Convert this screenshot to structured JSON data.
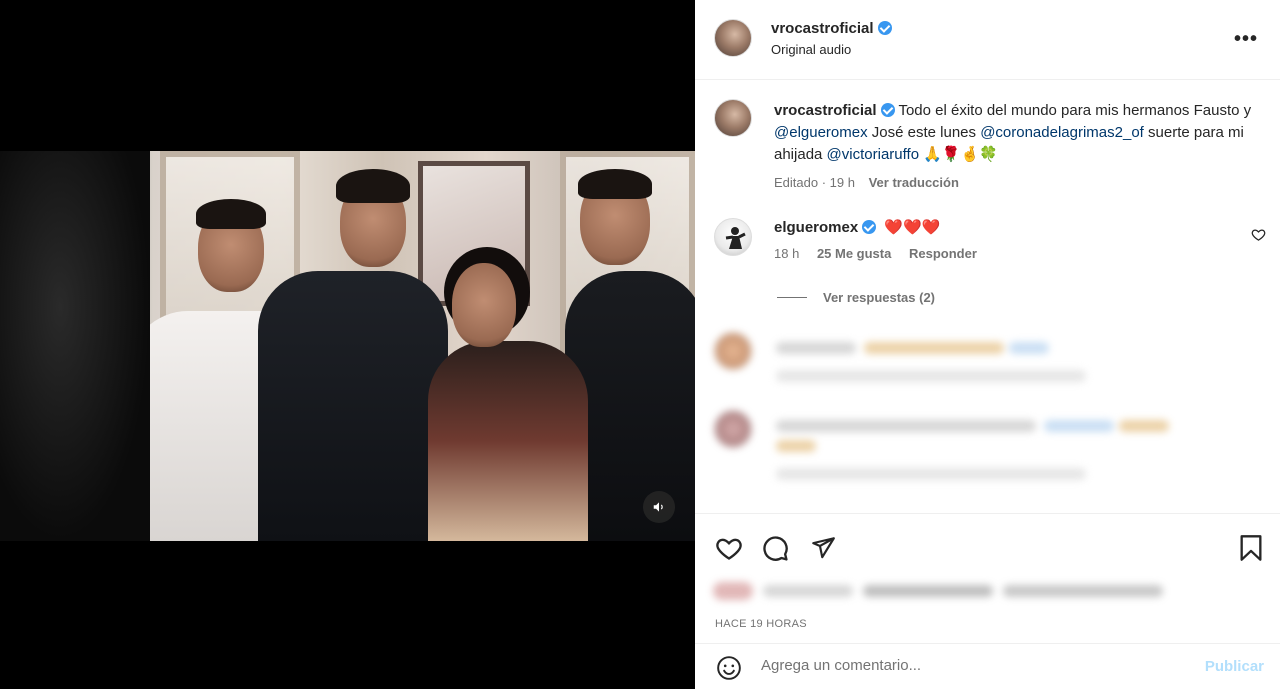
{
  "post": {
    "author": "vrocastroficial",
    "audio": "Original audio",
    "more_label": "•••"
  },
  "caption": {
    "username": "vrocastroficial",
    "text_1": " Todo el éxito del mundo para mis hermanos Fausto y ",
    "mention_1": "@elgueromex",
    "text_2": " José este lunes ",
    "mention_2": "@coronadelagrimas2_of",
    "text_3": " suerte para mi ahijada ",
    "mention_3": "@victoriaruffo",
    "emojis": " 🙏🌹🤞🍀",
    "edited": "Editado",
    "age": "19 h",
    "translate": "Ver traducción"
  },
  "comment": {
    "username": "elgueromex",
    "text": "❤️❤️❤️",
    "age": "18 h",
    "likes": "25 Me gusta",
    "reply": "Responder",
    "view_replies": "Ver respuestas (2)"
  },
  "footer": {
    "timestamp": "HACE 19 HORAS",
    "comment_placeholder": "Agrega un comentario...",
    "publish": "Publicar"
  },
  "icons": {
    "like": "heart-icon",
    "comment": "comment-icon",
    "share": "share-icon",
    "save": "bookmark-icon",
    "emoji": "emoji-icon",
    "mute": "speaker-icon"
  },
  "colors": {
    "verified": "#3897f0",
    "mention": "#00376b",
    "publish_disabled": "#b2dffc",
    "secondary_text": "#737373"
  }
}
